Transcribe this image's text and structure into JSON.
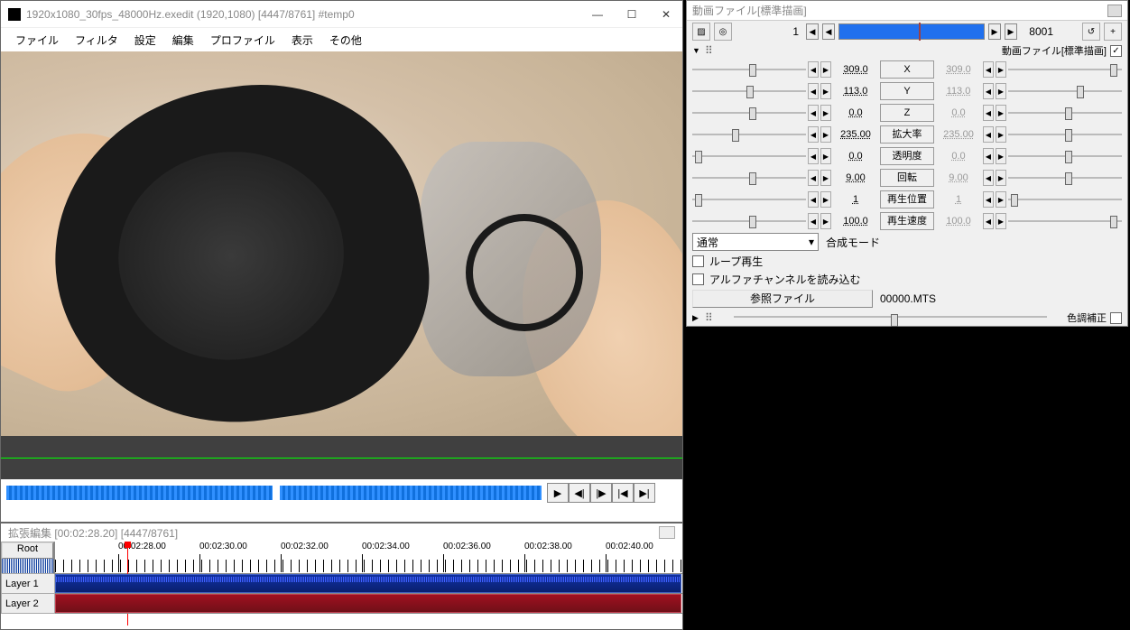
{
  "main": {
    "title": "1920x1080_30fps_48000Hz.exedit (1920,1080)  [4447/8761]  #temp0",
    "menu": [
      "ファイル",
      "フィルタ",
      "設定",
      "編集",
      "プロファイル",
      "表示",
      "その他"
    ],
    "play_icons": [
      "▶",
      "◀|",
      "|▶",
      "|◀",
      "▶|"
    ]
  },
  "timeline": {
    "title": "拡張編集 [00:02:28.20] [4447/8761]",
    "root": "Root",
    "layers": [
      "Layer 1",
      "Layer 2"
    ],
    "ticks": [
      "00:02:28.00",
      "00:02:30.00",
      "00:02:32.00",
      "00:02:34.00",
      "00:02:36.00",
      "00:02:38.00",
      "00:02:40.00"
    ]
  },
  "props": {
    "title": "動画ファイル[標準描画]",
    "frame_cur": "1",
    "frame_total": "8001",
    "header1": "動画ファイル[標準描画]",
    "params": [
      {
        "name": "X",
        "l": "309.0",
        "r": "309.0",
        "lp": 50,
        "rp": 90
      },
      {
        "name": "Y",
        "l": "113.0",
        "r": "113.0",
        "lp": 48,
        "rp": 60
      },
      {
        "name": "Z",
        "l": "0.0",
        "r": "0.0",
        "lp": 50,
        "rp": 50
      },
      {
        "name": "拡大率",
        "l": "235.00",
        "r": "235.00",
        "lp": 35,
        "rp": 50
      },
      {
        "name": "透明度",
        "l": "0.0",
        "r": "0.0",
        "lp": 2,
        "rp": 50
      },
      {
        "name": "回転",
        "l": "9.00",
        "r": "9.00",
        "lp": 50,
        "rp": 50
      },
      {
        "name": "再生位置",
        "l": "1",
        "r": "1",
        "lp": 2,
        "rp": 2
      },
      {
        "name": "再生速度",
        "l": "100.0",
        "r": "100.0",
        "lp": 50,
        "rp": 90
      }
    ],
    "blend_label": "合成モード",
    "blend_value": "通常",
    "chk_loop": "ループ再生",
    "chk_alpha": "アルファチャンネルを読み込む",
    "ref_btn": "参照ファイル",
    "ref_val": "00000.MTS",
    "header2": "色調補正"
  }
}
